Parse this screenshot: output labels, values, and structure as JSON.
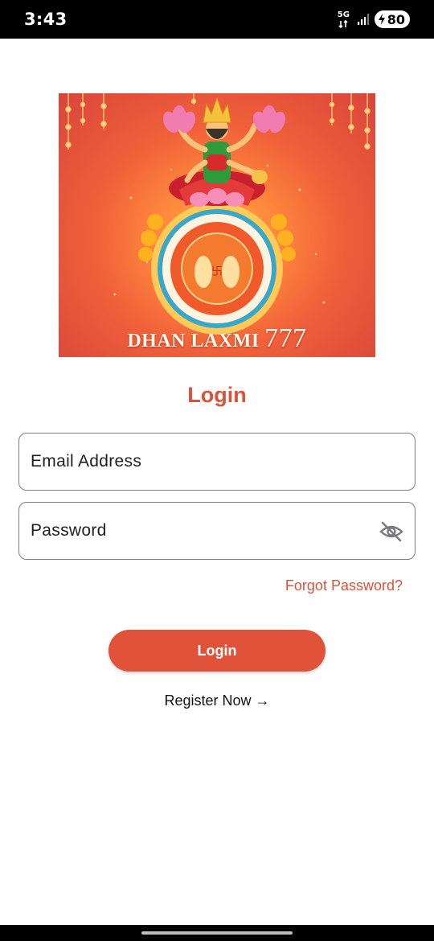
{
  "status_bar": {
    "time": "3:43",
    "network": "5G",
    "battery": "80"
  },
  "banner": {
    "title_text": "DHAN LAXMI",
    "title_number": "777"
  },
  "login": {
    "heading": "Login",
    "email_placeholder": "Email Address",
    "password_placeholder": "Password",
    "forgot_password": "Forgot Password?",
    "login_button": "Login",
    "register": "Register Now →"
  },
  "colors": {
    "accent": "#e0533a",
    "heading": "#d9533a"
  },
  "icons": {
    "password_toggle": "eye-off-icon"
  }
}
